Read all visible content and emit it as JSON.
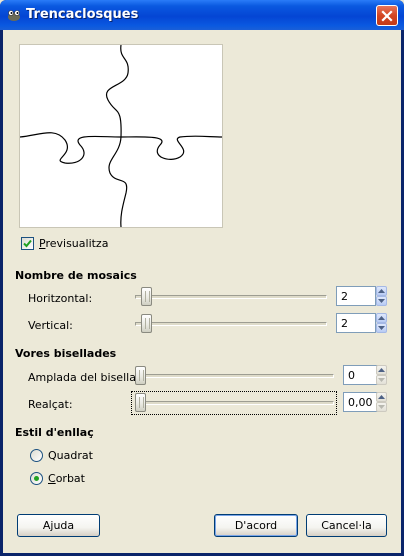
{
  "window": {
    "title": "Trencaclosques",
    "app_icon": "gimp-wilber-icon",
    "close_icon": "close-icon"
  },
  "preview": {
    "checkbox_label": "Previsualitza",
    "checked": true
  },
  "tile_count": {
    "heading": "Nombre de mosaics",
    "horizontal": {
      "label": "Horitzontal:",
      "value": "2",
      "slider_fraction": 0.02
    },
    "vertical": {
      "label": "Vertical:",
      "value": "2",
      "slider_fraction": 0.02
    }
  },
  "bevel": {
    "heading": "Vores bisellades",
    "bevel_width": {
      "label": "Amplada del bisellat:",
      "value": "0",
      "slider_fraction": 0.0
    },
    "highlight": {
      "label": "Realçat:",
      "value": "0,00",
      "slider_fraction": 0.0
    }
  },
  "jigsaw_style": {
    "heading": "Estil d'enllaç",
    "options": [
      {
        "label": "Quadrat",
        "selected": false
      },
      {
        "label": "Corbat",
        "selected": true
      }
    ]
  },
  "buttons": {
    "help": "Ajuda",
    "ok": "D'acord",
    "cancel": "Cancel·la"
  },
  "colors": {
    "title_bar": "#0445d4",
    "dialog_bg": "#ece9d8",
    "radio_dot": "#21a121"
  }
}
